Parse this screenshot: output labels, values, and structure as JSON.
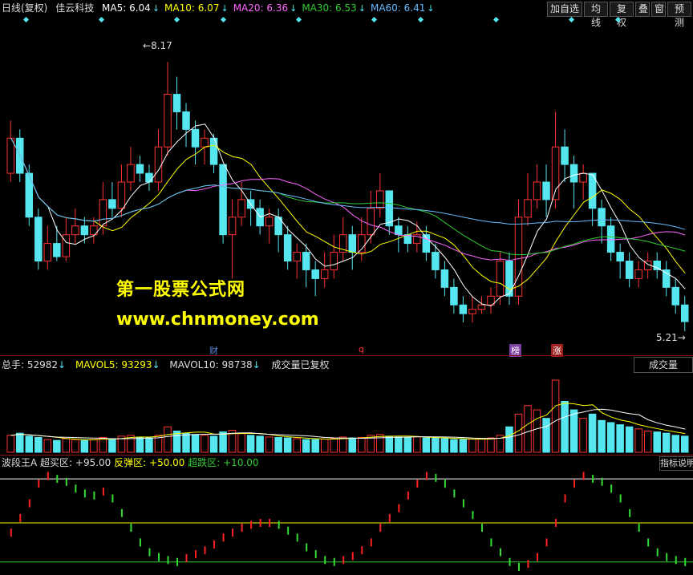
{
  "main": {
    "period": "日线(复权)",
    "stock": "佳云科技",
    "ma": [
      {
        "label": "MA5: 6.04",
        "color": "#ffffff"
      },
      {
        "label": "MA10: 6.07",
        "color": "#ffff00"
      },
      {
        "label": "MA20: 6.36",
        "color": "#ff66ff"
      },
      {
        "label": "MA30: 6.53",
        "color": "#33cc33"
      },
      {
        "label": "MA60: 6.41",
        "color": "#66bbff"
      }
    ],
    "buttons": [
      "加自选",
      "均线",
      "复权",
      "叠",
      "窗",
      "预测"
    ],
    "high_label": "8.17",
    "low_label": "5.21",
    "watermark_cn": "第一股票公式网",
    "watermark_url": "www.chnmoney.com",
    "event_tags": [
      {
        "text": "财",
        "color": "#5b8bd8",
        "bg": "transparent",
        "pos": 0.3
      },
      {
        "text": "q",
        "color": "#ff3333",
        "bg": "transparent",
        "pos": 0.515
      },
      {
        "text": "榜",
        "color": "#ffffff",
        "bg": "#7a3fa0",
        "pos": 0.735
      },
      {
        "text": "涨",
        "color": "#ffffff",
        "bg": "#a02020",
        "pos": 0.795
      }
    ]
  },
  "volume": {
    "total": "总手: 52982",
    "mavol5": "MAVOL5: 93293",
    "mavol10": "MAVOL10: 98738",
    "note": "成交量已复权",
    "tab": "成交量"
  },
  "indicator": {
    "name": "波段王A",
    "overbuy": "超买区: +95.00",
    "rebound": "反弹区: +50.00",
    "oversold": "超跌区: +10.00",
    "tab": "指标说明"
  },
  "colors": {
    "up": "#ff3333",
    "down": "#55e6f0",
    "ind_up": "#ff2222",
    "ind_down": "#33dd33"
  },
  "chart_data": {
    "type": "candlestick",
    "price_range": [
      5.0,
      8.6
    ],
    "candles": [
      [
        6.9,
        7.3,
        7.5,
        6.8
      ],
      [
        7.3,
        6.9,
        7.4,
        6.8
      ],
      [
        6.9,
        6.4,
        7.0,
        6.3
      ],
      [
        6.4,
        5.9,
        6.5,
        5.8
      ],
      [
        5.9,
        6.1,
        6.3,
        5.8
      ],
      [
        6.1,
        5.95,
        6.3,
        5.9
      ],
      [
        5.95,
        6.2,
        6.4,
        5.9
      ],
      [
        6.2,
        6.3,
        6.5,
        6.1
      ],
      [
        6.3,
        6.2,
        6.4,
        6.1
      ],
      [
        6.2,
        6.3,
        6.4,
        6.1
      ],
      [
        6.3,
        6.6,
        6.8,
        6.2
      ],
      [
        6.6,
        6.5,
        6.8,
        6.4
      ],
      [
        6.5,
        6.8,
        7.0,
        6.4
      ],
      [
        6.8,
        7.0,
        7.2,
        6.7
      ],
      [
        7.0,
        6.9,
        7.1,
        6.8
      ],
      [
        6.9,
        6.8,
        7.0,
        6.7
      ],
      [
        6.8,
        7.2,
        7.4,
        6.7
      ],
      [
        7.2,
        7.8,
        8.17,
        7.1
      ],
      [
        7.8,
        7.6,
        8.0,
        7.4
      ],
      [
        7.6,
        7.4,
        7.7,
        7.2
      ],
      [
        7.4,
        7.2,
        7.5,
        7.0
      ],
      [
        7.2,
        7.3,
        7.4,
        7.0
      ],
      [
        7.3,
        7.0,
        7.35,
        6.9
      ],
      [
        7.0,
        6.2,
        7.0,
        6.1
      ],
      [
        6.2,
        6.4,
        6.6,
        5.7
      ],
      [
        6.4,
        6.6,
        6.8,
        6.3
      ],
      [
        6.6,
        6.5,
        6.7,
        6.3
      ],
      [
        6.5,
        6.3,
        6.6,
        6.2
      ],
      [
        6.3,
        6.4,
        6.5,
        6.1
      ],
      [
        6.4,
        6.2,
        6.5,
        6.0
      ],
      [
        6.2,
        5.9,
        6.3,
        5.8
      ],
      [
        5.9,
        6.0,
        6.1,
        5.7
      ],
      [
        6.0,
        5.8,
        6.1,
        5.6
      ],
      [
        5.8,
        5.7,
        5.9,
        5.5
      ],
      [
        5.7,
        5.8,
        6.0,
        5.6
      ],
      [
        5.8,
        6.0,
        6.2,
        5.7
      ],
      [
        6.0,
        6.2,
        6.4,
        5.9
      ],
      [
        6.2,
        6.0,
        6.3,
        5.8
      ],
      [
        6.0,
        6.2,
        6.4,
        5.9
      ],
      [
        6.2,
        6.5,
        6.7,
        6.1
      ],
      [
        6.5,
        6.7,
        6.9,
        6.4
      ],
      [
        6.7,
        6.3,
        6.7,
        6.2
      ],
      [
        6.3,
        6.2,
        6.4,
        6.0
      ],
      [
        6.2,
        6.1,
        6.3,
        6.0
      ],
      [
        6.1,
        6.2,
        6.35,
        6.0
      ],
      [
        6.2,
        6.0,
        6.3,
        5.9
      ],
      [
        6.0,
        5.8,
        6.1,
        5.7
      ],
      [
        5.8,
        5.6,
        5.9,
        5.5
      ],
      [
        5.6,
        5.4,
        5.7,
        5.3
      ],
      [
        5.4,
        5.3,
        5.5,
        5.2
      ],
      [
        5.3,
        5.35,
        5.5,
        5.2
      ],
      [
        5.35,
        5.4,
        5.5,
        5.3
      ],
      [
        5.4,
        5.5,
        5.6,
        5.3
      ],
      [
        5.5,
        5.9,
        6.0,
        5.4
      ],
      [
        5.9,
        5.5,
        6.0,
        5.4
      ],
      [
        5.5,
        6.4,
        6.6,
        5.4
      ],
      [
        6.4,
        6.6,
        6.9,
        6.3
      ],
      [
        6.6,
        6.8,
        7.0,
        6.5
      ],
      [
        6.8,
        6.6,
        7.0,
        6.4
      ],
      [
        6.6,
        7.2,
        7.6,
        6.5
      ],
      [
        7.2,
        7.0,
        7.4,
        6.8
      ],
      [
        7.0,
        6.8,
        7.1,
        6.5
      ],
      [
        6.8,
        6.9,
        7.0,
        6.6
      ],
      [
        6.9,
        6.5,
        6.9,
        6.3
      ],
      [
        6.5,
        6.3,
        6.6,
        6.1
      ],
      [
        6.3,
        6.0,
        6.4,
        5.9
      ],
      [
        6.0,
        5.9,
        6.1,
        5.7
      ],
      [
        5.9,
        5.7,
        6.0,
        5.6
      ],
      [
        5.7,
        5.8,
        5.9,
        5.6
      ],
      [
        5.8,
        5.9,
        6.0,
        5.7
      ],
      [
        5.9,
        5.8,
        6.0,
        5.7
      ],
      [
        5.8,
        5.6,
        5.9,
        5.5
      ],
      [
        5.6,
        5.4,
        5.7,
        5.3
      ],
      [
        5.4,
        5.21,
        5.5,
        5.1
      ]
    ],
    "volume": [
      40,
      45,
      38,
      35,
      30,
      28,
      32,
      30,
      28,
      30,
      35,
      32,
      38,
      40,
      36,
      34,
      40,
      60,
      50,
      45,
      42,
      40,
      38,
      48,
      52,
      44,
      40,
      38,
      36,
      35,
      34,
      32,
      30,
      30,
      31,
      33,
      36,
      34,
      35,
      40,
      42,
      38,
      36,
      35,
      36,
      34,
      33,
      32,
      30,
      30,
      31,
      32,
      34,
      40,
      60,
      90,
      110,
      100,
      80,
      170,
      120,
      100,
      80,
      90,
      75,
      70,
      65,
      60,
      55,
      50,
      48,
      45,
      40,
      38
    ],
    "indicator": [
      40,
      55,
      70,
      90,
      98,
      95,
      92,
      85,
      80,
      78,
      82,
      75,
      60,
      45,
      30,
      20,
      15,
      12,
      10,
      14,
      18,
      22,
      28,
      35,
      40,
      45,
      48,
      50,
      50,
      48,
      42,
      35,
      25,
      18,
      12,
      10,
      12,
      16,
      22,
      30,
      45,
      55,
      65,
      78,
      90,
      98,
      96,
      90,
      80,
      70,
      58,
      45,
      30,
      20,
      10,
      5,
      8,
      15,
      30,
      50,
      75,
      90,
      98,
      95,
      92,
      85,
      75,
      60,
      45,
      30,
      20,
      15,
      12,
      10
    ]
  }
}
